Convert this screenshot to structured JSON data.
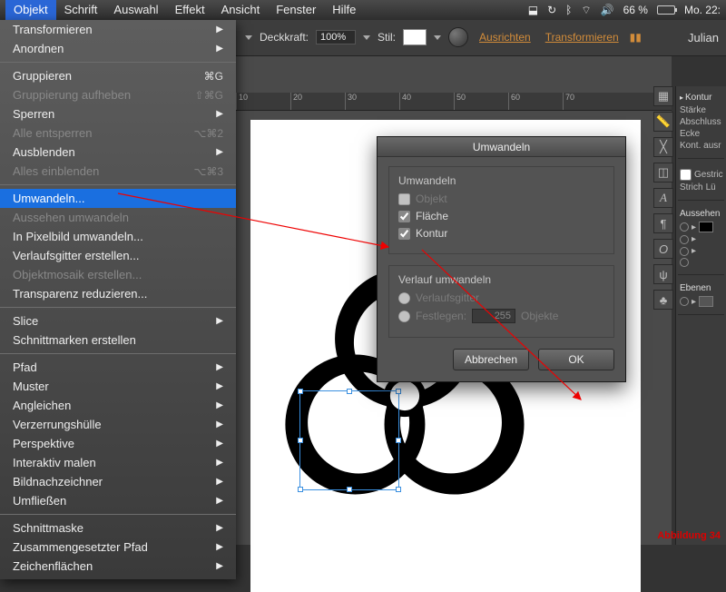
{
  "menubar": {
    "items": [
      "Objekt",
      "Schrift",
      "Auswahl",
      "Effekt",
      "Ansicht",
      "Fenster",
      "Hilfe"
    ],
    "active_index": 0,
    "sys": {
      "battery_pct": "66 %",
      "time": "Mo. 22:"
    }
  },
  "doc_title": "Julian",
  "options": {
    "opacity_label": "Deckkraft:",
    "opacity_value": "100%",
    "style_label": "Stil:",
    "align": "Ausrichten",
    "transform": "Transformieren"
  },
  "dropdown": {
    "groups": [
      [
        {
          "label": "Transformieren",
          "submenu": true
        },
        {
          "label": "Anordnen",
          "submenu": true
        }
      ],
      [
        {
          "label": "Gruppieren",
          "shortcut": "⌘G"
        },
        {
          "label": "Gruppierung aufheben",
          "shortcut": "⇧⌘G",
          "disabled": true
        },
        {
          "label": "Sperren",
          "submenu": true
        },
        {
          "label": "Alle entsperren",
          "shortcut": "⌥⌘2",
          "disabled": true
        },
        {
          "label": "Ausblenden",
          "submenu": true
        },
        {
          "label": "Alles einblenden",
          "shortcut": "⌥⌘3",
          "disabled": true
        }
      ],
      [
        {
          "label": "Umwandeln...",
          "selected": true
        },
        {
          "label": "Aussehen umwandeln",
          "disabled": true
        },
        {
          "label": "In Pixelbild umwandeln..."
        },
        {
          "label": "Verlaufsgitter erstellen..."
        },
        {
          "label": "Objektmosaik erstellen...",
          "disabled": true
        },
        {
          "label": "Transparenz reduzieren..."
        }
      ],
      [
        {
          "label": "Slice",
          "submenu": true
        },
        {
          "label": "Schnittmarken erstellen"
        }
      ],
      [
        {
          "label": "Pfad",
          "submenu": true
        },
        {
          "label": "Muster",
          "submenu": true
        },
        {
          "label": "Angleichen",
          "submenu": true
        },
        {
          "label": "Verzerrungshülle",
          "submenu": true
        },
        {
          "label": "Perspektive",
          "submenu": true
        },
        {
          "label": "Interaktiv malen",
          "submenu": true
        },
        {
          "label": "Bildnachzeichner",
          "submenu": true
        },
        {
          "label": "Umfließen",
          "submenu": true
        }
      ],
      [
        {
          "label": "Schnittmaske",
          "submenu": true
        },
        {
          "label": "Zusammengesetzter Pfad",
          "submenu": true
        },
        {
          "label": "Zeichenflächen",
          "submenu": true
        }
      ]
    ]
  },
  "ruler_ticks": [
    "10",
    "20",
    "30",
    "40",
    "50",
    "60",
    "70"
  ],
  "dialog": {
    "title": "Umwandeln",
    "group1_title": "Umwandeln",
    "objekt": "Objekt",
    "flaeche": "Fläche",
    "kontur": "Kontur",
    "group2_title": "Verlauf umwandeln",
    "gitter": "Verlaufsgitter",
    "festlegen": "Festlegen:",
    "festlegen_val": "255",
    "objekte": "Objekte",
    "cancel": "Abbrechen",
    "ok": "OK"
  },
  "panels": {
    "kontur": "Kontur",
    "starke": "Stärke",
    "abschluss": "Abschluss",
    "ecke": "Ecke",
    "kont_ausr": "Kont. ausr",
    "gestrich": "Gestric",
    "strich": "Strich",
    "lu": "Lü",
    "aussehen": "Aussehen",
    "ebenen": "Ebenen"
  },
  "caption": "Abbildung 34"
}
